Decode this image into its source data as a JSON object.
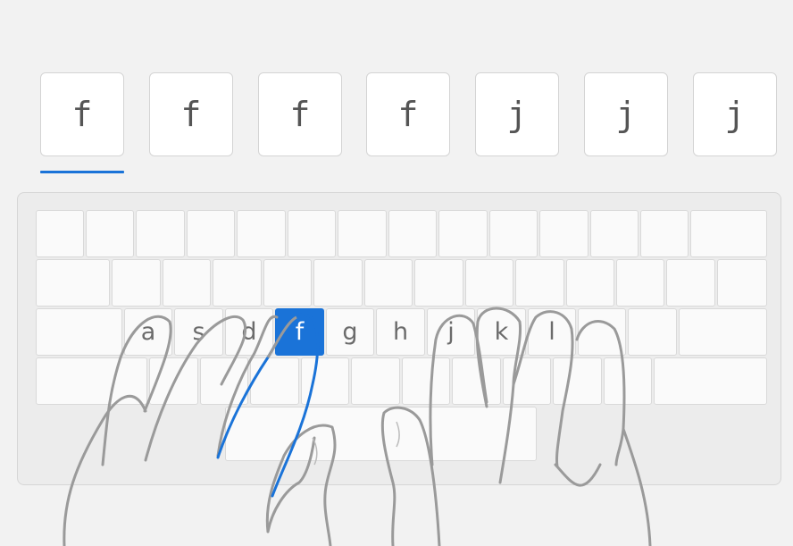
{
  "exercise": {
    "letters": [
      "f",
      "f",
      "f",
      "f",
      "j",
      "j",
      "j"
    ],
    "current_index": 0
  },
  "keyboard": {
    "home_row": {
      "a": "a",
      "s": "s",
      "d": "d",
      "f": "f",
      "g": "g",
      "h": "h",
      "j": "j",
      "k": "k",
      "l": "l"
    },
    "highlighted_key": "f"
  },
  "colors": {
    "accent": "#1a73d8",
    "background": "#f2f2f2",
    "hand_outline": "#999999",
    "active_finger": "#1a73d8"
  }
}
